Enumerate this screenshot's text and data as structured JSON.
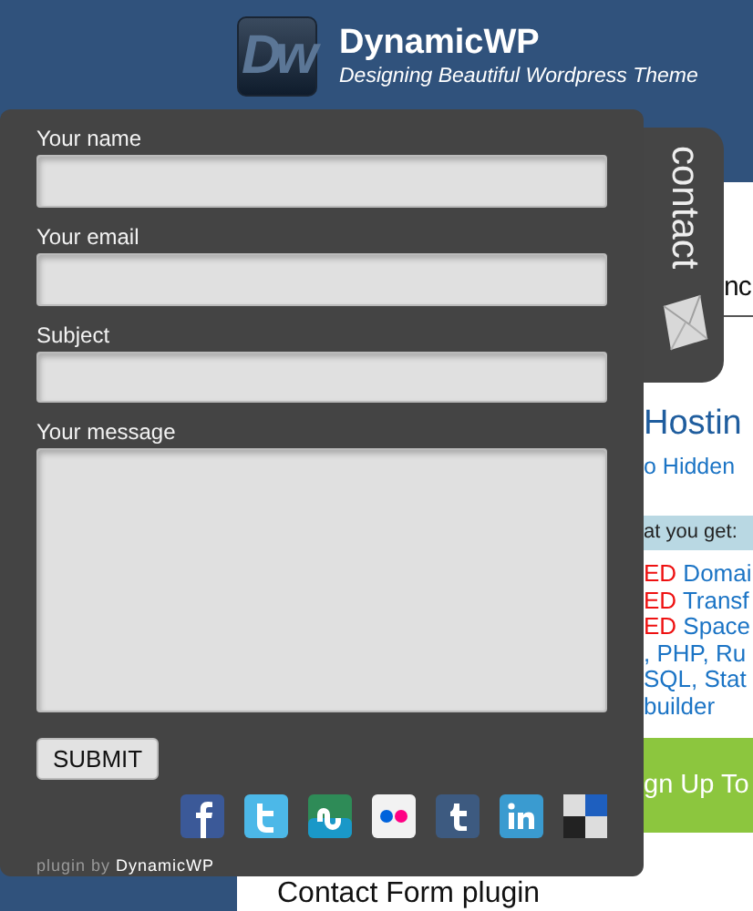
{
  "header": {
    "logo_text": "Dw",
    "title": "DynamicWP",
    "tagline": "Designing Beautiful Wordpress Theme"
  },
  "background_page": {
    "heading": "nc",
    "subheading": "Hostin",
    "link": "o Hidden",
    "band": "at you get:",
    "features": [
      {
        "highlight": "ED",
        "text": " Domai"
      },
      {
        "highlight": "ED",
        "text": " Transf"
      },
      {
        "highlight": "ED",
        "text": " Space"
      },
      {
        "text": ", PHP, Ru"
      },
      {
        "text": "SQL, Stat"
      },
      {
        "text": "builder"
      }
    ],
    "signup": "gn Up To",
    "post_title": "Contact Form plugin"
  },
  "contact_tab": {
    "label": "contact"
  },
  "contact_form": {
    "fields": [
      {
        "label": "Your name",
        "kind": "input"
      },
      {
        "label": "Your email",
        "kind": "input"
      },
      {
        "label": "Subject",
        "kind": "input"
      },
      {
        "label": "Your message",
        "kind": "textarea"
      }
    ],
    "submit": "SUBMIT",
    "social": [
      {
        "kind": "facebook"
      },
      {
        "kind": "twitter"
      },
      {
        "kind": "stumbleupon"
      },
      {
        "kind": "flickr"
      },
      {
        "kind": "tumblr"
      },
      {
        "kind": "linkedin"
      },
      {
        "kind": "delicious"
      }
    ],
    "credit_prefix": "plugin by",
    "credit_link": "DynamicWP"
  }
}
